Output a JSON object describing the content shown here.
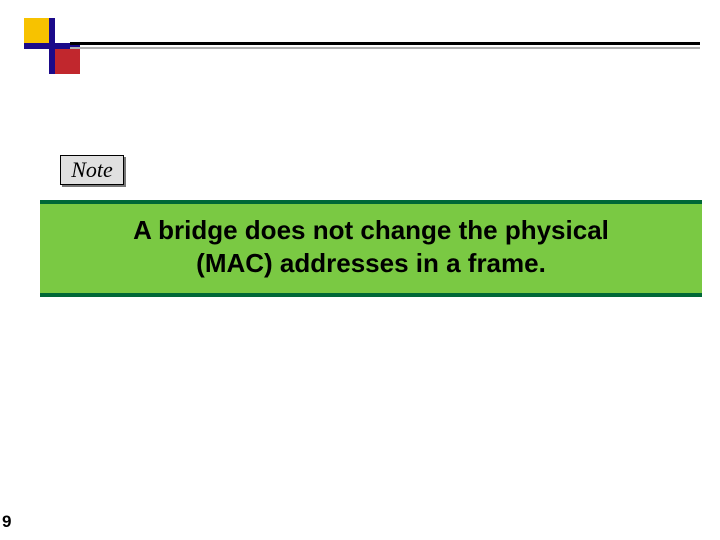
{
  "note_label": "Note",
  "banner": {
    "line1": "A bridge does not change the physical",
    "line2": "(MAC) addresses in a frame."
  },
  "page_number": "9",
  "colors": {
    "banner_bg": "#7ac943",
    "banner_border": "#006837",
    "logo_yellow": "#f7c200",
    "logo_red": "#c1272d",
    "logo_blue": "#1b0a8a"
  }
}
